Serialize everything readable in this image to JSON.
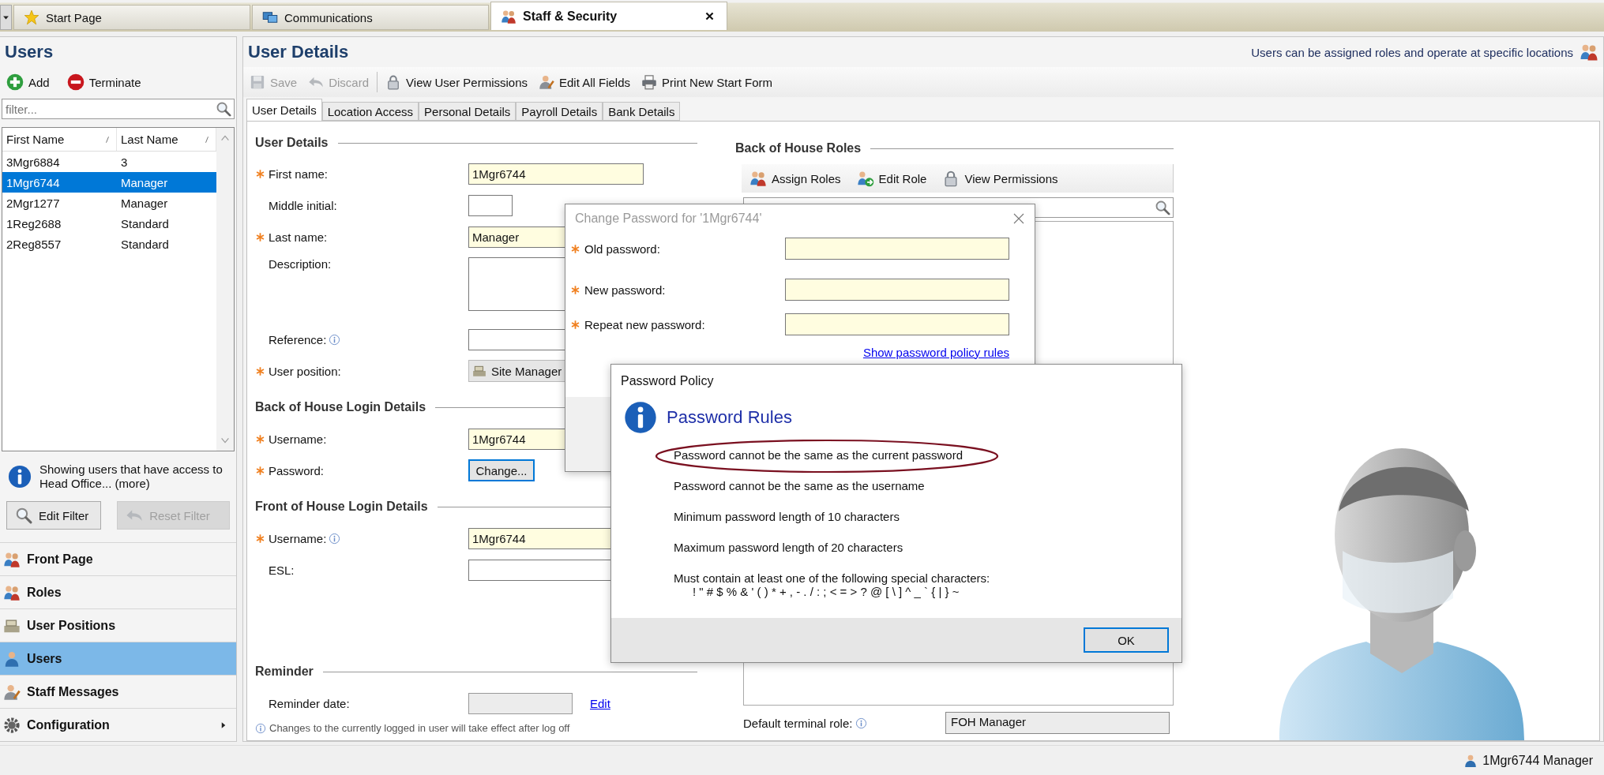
{
  "tab_strip": {
    "tabs": [
      {
        "label": "Start Page",
        "selected": false,
        "closable": false
      },
      {
        "label": "Communications",
        "selected": false,
        "closable": false
      },
      {
        "label": "Staff & Security",
        "selected": true,
        "closable": true
      }
    ]
  },
  "users_panel": {
    "title": "Users",
    "actions": [
      {
        "label": "Add"
      },
      {
        "label": "Terminate"
      }
    ],
    "filter": {
      "placeholder": "filter..."
    },
    "grid": {
      "columns": [
        "First Name",
        "Last Name"
      ],
      "rows": [
        {
          "first_name": "3Mgr6884",
          "last_name": "3",
          "selected": false
        },
        {
          "first_name": "1Mgr6744",
          "last_name": "Manager",
          "selected": true
        },
        {
          "first_name": "2Mgr1277",
          "last_name": "Manager",
          "selected": false
        },
        {
          "first_name": "1Reg2688",
          "last_name": "Standard",
          "selected": false
        },
        {
          "first_name": "2Reg8557",
          "last_name": "Standard",
          "selected": false
        }
      ]
    },
    "info": "Showing users that have access to Head Office... (more)",
    "buttons": [
      {
        "label": "Edit Filter",
        "disabled": false
      },
      {
        "label": "Reset Filter",
        "disabled": true
      }
    ]
  },
  "nav": [
    {
      "label": "Front Page",
      "selected": false,
      "submenu": false
    },
    {
      "label": "Roles",
      "selected": false,
      "submenu": false
    },
    {
      "label": "User Positions",
      "selected": false,
      "submenu": false
    },
    {
      "label": "Users",
      "selected": true,
      "submenu": false
    },
    {
      "label": "Staff Messages",
      "selected": false,
      "submenu": false
    },
    {
      "label": "Configuration",
      "selected": false,
      "submenu": true
    }
  ],
  "details": {
    "title": "User Details",
    "hint": "Users can be assigned roles and operate at specific locations",
    "toolbar": [
      {
        "label": "Save",
        "disabled": true,
        "separator": false
      },
      {
        "label": "Discard",
        "disabled": true,
        "separator": true
      },
      {
        "label": "View User Permissions",
        "disabled": false,
        "separator": false
      },
      {
        "label": "Edit All Fields",
        "disabled": false,
        "separator": false
      },
      {
        "label": "Print New Start Form",
        "disabled": false,
        "separator": false
      }
    ],
    "tabs": [
      {
        "label": "User Details",
        "selected": true
      },
      {
        "label": "Location Access",
        "selected": false
      },
      {
        "label": "Personal Details",
        "selected": false
      },
      {
        "label": "Payroll Details",
        "selected": false
      },
      {
        "label": "Bank Details",
        "selected": false
      }
    ],
    "sections": [
      {
        "title": "User Details",
        "fields": [
          {
            "kind": "text",
            "label": "First name:",
            "required": true,
            "info": false,
            "value": "1Mgr6744"
          },
          {
            "kind": "initial",
            "label": "Middle initial:",
            "required": false,
            "info": false
          },
          {
            "kind": "text",
            "label": "Last name:",
            "required": true,
            "info": false,
            "value": "Manager"
          },
          {
            "kind": "textarea",
            "label": "Description:",
            "required": false,
            "info": false
          },
          {
            "kind": "text",
            "label": "Reference:",
            "required": false,
            "info": true
          },
          {
            "kind": "picker",
            "label": "User position:",
            "required": true,
            "info": false,
            "value": "Site Manager"
          }
        ]
      },
      {
        "title": "Back of House Login Details",
        "fields": [
          {
            "kind": "text",
            "label": "Username:",
            "required": true,
            "info": false,
            "value": "1Mgr6744"
          },
          {
            "kind": "button",
            "label": "Password:",
            "required": true,
            "info": false,
            "value": "Change..."
          }
        ]
      },
      {
        "title": "Front of House Login Details",
        "fields": [
          {
            "kind": "text",
            "label": "Username:",
            "required": true,
            "info": true,
            "value": "1Mgr6744"
          },
          {
            "kind": "text",
            "label": "ESL:",
            "required": false,
            "info": false
          }
        ]
      },
      {
        "title": "Reminder",
        "fields": [
          {
            "kind": "date",
            "label": "Reminder date:",
            "required": false,
            "info": false,
            "link": "Edit"
          }
        ]
      }
    ],
    "note": "Changes to the currently logged in user will take effect after log off",
    "roles": {
      "title": "Back of House Roles",
      "toolbar": [
        {
          "label": "Assign Roles"
        },
        {
          "label": "Edit Role"
        },
        {
          "label": "View Permissions"
        }
      ],
      "default_role": {
        "label": "Default terminal role:",
        "value": "FOH Manager"
      }
    }
  },
  "change_password_dialog": {
    "title": "Change Password for '1Mgr6744'",
    "fields": [
      {
        "label": "Old password:",
        "required": true
      },
      {
        "label": "New password:",
        "required": true
      },
      {
        "label": "Repeat new password:",
        "required": true
      }
    ],
    "link": "Show password policy rules"
  },
  "policy_dialog": {
    "title": "Password Policy",
    "heading": "Password Rules",
    "rules": [
      {
        "text": "Password cannot be the same as the current password",
        "circled": true
      },
      {
        "text": "Password cannot be the same as the username",
        "circled": false
      },
      {
        "text": "Minimum password length of 10 characters",
        "circled": false
      },
      {
        "text": "Maximum password length of 20 characters",
        "circled": false
      },
      {
        "text": "Must contain at  least one of the following special characters:",
        "circled": false,
        "detail": "! \" # $ % & ' ( ) * + , - . / : ; < = > ? @ [ \\ ] ^ _ ` { | } ~"
      }
    ],
    "button": "OK"
  },
  "status_bar": {
    "user": "1Mgr6744 Manager"
  }
}
